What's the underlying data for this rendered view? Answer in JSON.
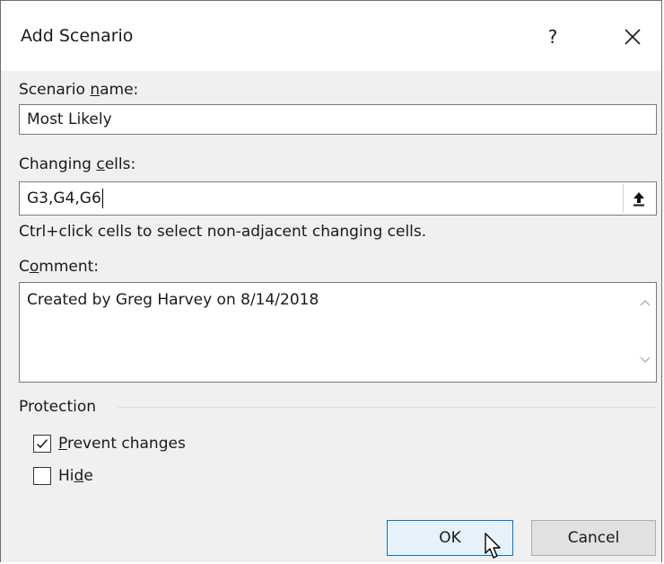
{
  "dialog": {
    "title": "Add Scenario",
    "help_label": "?",
    "close_label": "close"
  },
  "scenario_name": {
    "label_pre": "Scenario ",
    "label_key": "n",
    "label_post": "ame:",
    "value": "Most Likely"
  },
  "changing_cells": {
    "label_pre": "Changing ",
    "label_key": "c",
    "label_post": "ells:",
    "value": "G3,G4,G6",
    "hint": "Ctrl+click cells to select non-adjacent changing cells.",
    "collapse_icon": "collapse-dialog-icon"
  },
  "comment": {
    "label_pre": "C",
    "label_key": "o",
    "label_post": "mment:",
    "value": "Created by Greg Harvey on 8/14/2018"
  },
  "protection": {
    "heading": "Protection",
    "prevent_changes": {
      "label_key": "P",
      "label_post": "revent changes",
      "checked": true
    },
    "hide": {
      "label_pre": "Hi",
      "label_key": "d",
      "label_post": "e",
      "checked": false
    }
  },
  "buttons": {
    "ok": "OK",
    "cancel": "Cancel"
  },
  "colors": {
    "dialog_bg": "#f0f0f0",
    "ok_border": "#0078d7",
    "ok_bg": "#e5f1fb"
  }
}
